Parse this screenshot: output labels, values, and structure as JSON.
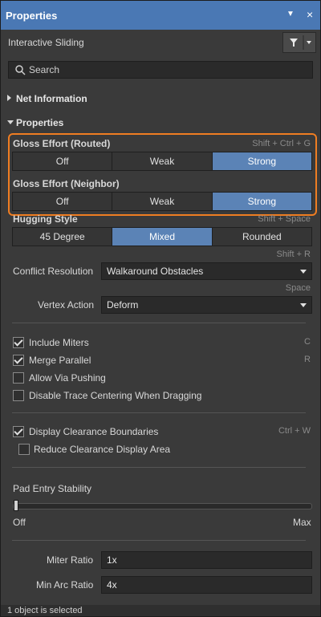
{
  "titlebar": {
    "title": "Properties",
    "pin_icon": "▼",
    "close_icon": "×"
  },
  "header": {
    "mode_label": "Interactive Sliding"
  },
  "search": {
    "placeholder": "Search"
  },
  "sections": {
    "net_information": "Net Information",
    "properties": "Properties"
  },
  "gloss_routed": {
    "label": "Gloss Effort (Routed)",
    "shortcut": "Shift + Ctrl + G",
    "options": [
      "Off",
      "Weak",
      "Strong"
    ],
    "selected": "Strong"
  },
  "gloss_neighbor": {
    "label": "Gloss Effort (Neighbor)",
    "options": [
      "Off",
      "Weak",
      "Strong"
    ],
    "selected": "Strong"
  },
  "hugging": {
    "label": "Hugging Style",
    "shortcut": "Shift + Space",
    "options": [
      "45 Degree",
      "Mixed",
      "Rounded"
    ],
    "selected": "Mixed"
  },
  "conflict": {
    "shortcut": "Shift + R",
    "label": "Conflict Resolution",
    "value": "Walkaround Obstacles"
  },
  "vertex": {
    "shortcut": "Space",
    "label": "Vertex Action",
    "value": "Deform"
  },
  "checkboxes": [
    {
      "label": "Include Miters",
      "checked": true,
      "shortcut": "C"
    },
    {
      "label": "Merge Parallel",
      "checked": true,
      "shortcut": "R"
    },
    {
      "label": "Allow Via Pushing",
      "checked": false,
      "shortcut": ""
    },
    {
      "label": "Disable Trace Centering When Dragging",
      "checked": false,
      "shortcut": ""
    }
  ],
  "clearance": {
    "display_label": "Display Clearance Boundaries",
    "display_checked": true,
    "display_shortcut": "Ctrl + W",
    "reduce_label": "Reduce Clearance Display Area",
    "reduce_checked": false
  },
  "pad_entry": {
    "label": "Pad Entry Stability",
    "min_label": "Off",
    "max_label": "Max",
    "value_fraction": 0.0
  },
  "miter": {
    "label": "Miter Ratio",
    "value": "1x"
  },
  "min_arc": {
    "label": "Min Arc Ratio",
    "value": "4x"
  },
  "status": {
    "text": "1 object is selected"
  },
  "colors": {
    "accent": "#4a78b4",
    "selected": "#5b83b6",
    "highlight": "#ef7d22"
  }
}
